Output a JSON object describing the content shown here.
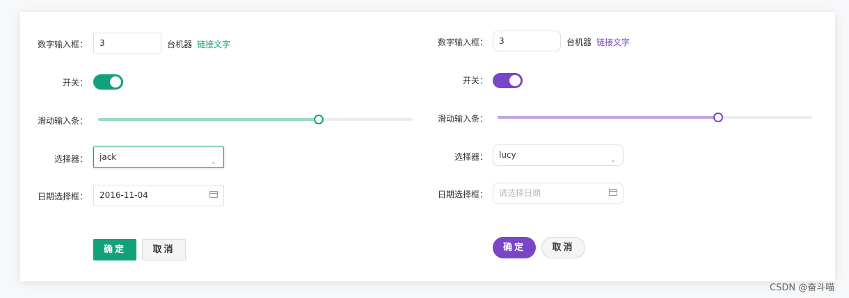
{
  "colors": {
    "green_accent": "#13a17c",
    "green_light": "#9ad9c3",
    "purple_accent": "#7b45c8",
    "purple_light": "#c0a6e4"
  },
  "left": {
    "number_label": "数字输入框：",
    "number_value": "3",
    "number_suffix": "台机器",
    "link_text": "链接文字",
    "switch_label": "开关：",
    "switch_on": true,
    "slider_label": "滑动输入条：",
    "slider_value_percent": 70,
    "select_label": "选择器：",
    "select_value": "jack",
    "date_label": "日期选择框：",
    "date_value": "2016-11-04",
    "confirm": "确定",
    "cancel": "取消"
  },
  "right": {
    "number_label": "数字输入框：",
    "number_value": "3",
    "number_suffix": "台机器",
    "link_text": "链接文字",
    "switch_label": "开关：",
    "switch_on": true,
    "slider_label": "滑动输入条：",
    "slider_value_percent": 70,
    "select_label": "选择器：",
    "select_value": "lucy",
    "date_label": "日期选择框：",
    "date_placeholder": "请选择日期",
    "confirm": "确定",
    "cancel": "取消"
  },
  "watermark": "CSDN @奋斗喵"
}
